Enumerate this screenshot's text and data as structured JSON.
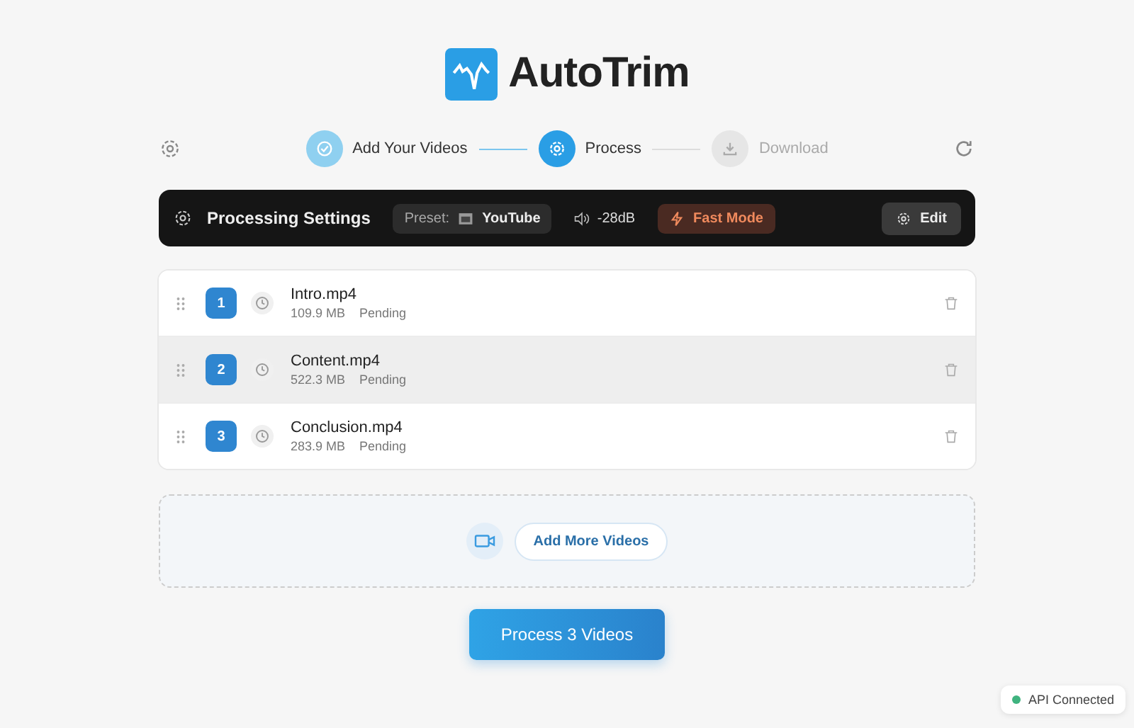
{
  "app": {
    "name": "AutoTrim"
  },
  "steps": [
    {
      "label": "Add Your Videos",
      "kind": "done"
    },
    {
      "label": "Process",
      "kind": "active"
    },
    {
      "label": "Download",
      "kind": "pending"
    }
  ],
  "settings_bar": {
    "title": "Processing Settings",
    "preset_label": "Preset:",
    "preset_value": "YouTube",
    "threshold": "-28dB",
    "mode": "Fast Mode",
    "edit_button": "Edit"
  },
  "files": [
    {
      "index": "1",
      "name": "Intro.mp4",
      "size": "109.9 MB",
      "status": "Pending",
      "selected": false
    },
    {
      "index": "2",
      "name": "Content.mp4",
      "size": "522.3 MB",
      "status": "Pending",
      "selected": true
    },
    {
      "index": "3",
      "name": "Conclusion.mp4",
      "size": "283.9 MB",
      "status": "Pending",
      "selected": false
    }
  ],
  "add_more_button": "Add More Videos",
  "process_button": "Process 3 Videos",
  "api_status": {
    "label": "API Connected",
    "color": "#3fb37f"
  }
}
